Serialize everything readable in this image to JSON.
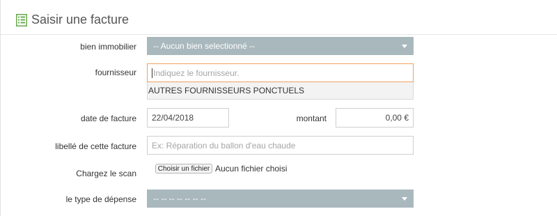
{
  "header": {
    "title": "Saisir une facture",
    "icon": "list-icon",
    "icon_color": "#6aa84f"
  },
  "form": {
    "property": {
      "label": "bien immobilier",
      "value": "-- Aucun bien selectionné --"
    },
    "supplier": {
      "label": "fournisseur",
      "placeholder": "Indiquez le fournisseur.",
      "suggestions": [
        "AUTRES FOURNISSEURS PONCTUELS"
      ]
    },
    "invoice_date": {
      "label": "date de facture",
      "value": "22/04/2018"
    },
    "amount": {
      "label": "montant",
      "value": "0,00 €"
    },
    "description": {
      "label": "libellé de cette facture",
      "placeholder": "Ex: Réparation du ballon d'eau chaude"
    },
    "scan": {
      "label": "Chargez le scan",
      "button_label": "Choisir un fichier",
      "status": "Aucun fichier choisi"
    },
    "expense_type": {
      "label": "le type de dépense",
      "value": "-- -- -- -- -- -- --"
    }
  },
  "colors": {
    "select_bg": "#a9b8bd",
    "focus_border": "#f0a060"
  }
}
